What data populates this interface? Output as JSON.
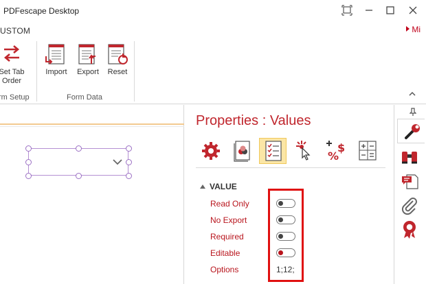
{
  "window": {
    "title": "PDFescape Desktop"
  },
  "ribbon": {
    "active_tab": "USTOM",
    "right_tab": "Mi",
    "buttons": {
      "tab_order": "Set Tab Order",
      "tab_order_line1": "Set Tab",
      "tab_order_line2": "Order",
      "import": "Import",
      "export": "Export",
      "reset": "Reset"
    },
    "groups": {
      "form_setup": "rm Setup",
      "form_data": "Form Data"
    }
  },
  "properties": {
    "title": "Properties : Values",
    "section": "VALUE",
    "rows": [
      {
        "label": "Read Only",
        "type": "toggle",
        "on": false
      },
      {
        "label": "No Export",
        "type": "toggle",
        "on": false
      },
      {
        "label": "Required",
        "type": "toggle",
        "on": false
      },
      {
        "label": "Editable",
        "type": "toggle",
        "on": true
      },
      {
        "label": "Options",
        "type": "text",
        "value": "1;12;"
      }
    ],
    "icons": [
      "gear-icon",
      "appearance-icon",
      "values-list-icon",
      "actions-click-icon",
      "format-percent-dollar-icon",
      "calculate-icon"
    ],
    "active_icon": "values-list-icon"
  },
  "sidebar": {
    "icons": [
      "wrench-icon",
      "binoculars-icon",
      "comment-page-icon",
      "paperclip-icon",
      "certificate-icon"
    ]
  },
  "colors": {
    "accent": "#c0262d",
    "label_red": "#b8141c",
    "highlight": "#e01010",
    "active_icon_bg": "#fbe6a6",
    "field_border": "#b48fd3"
  }
}
